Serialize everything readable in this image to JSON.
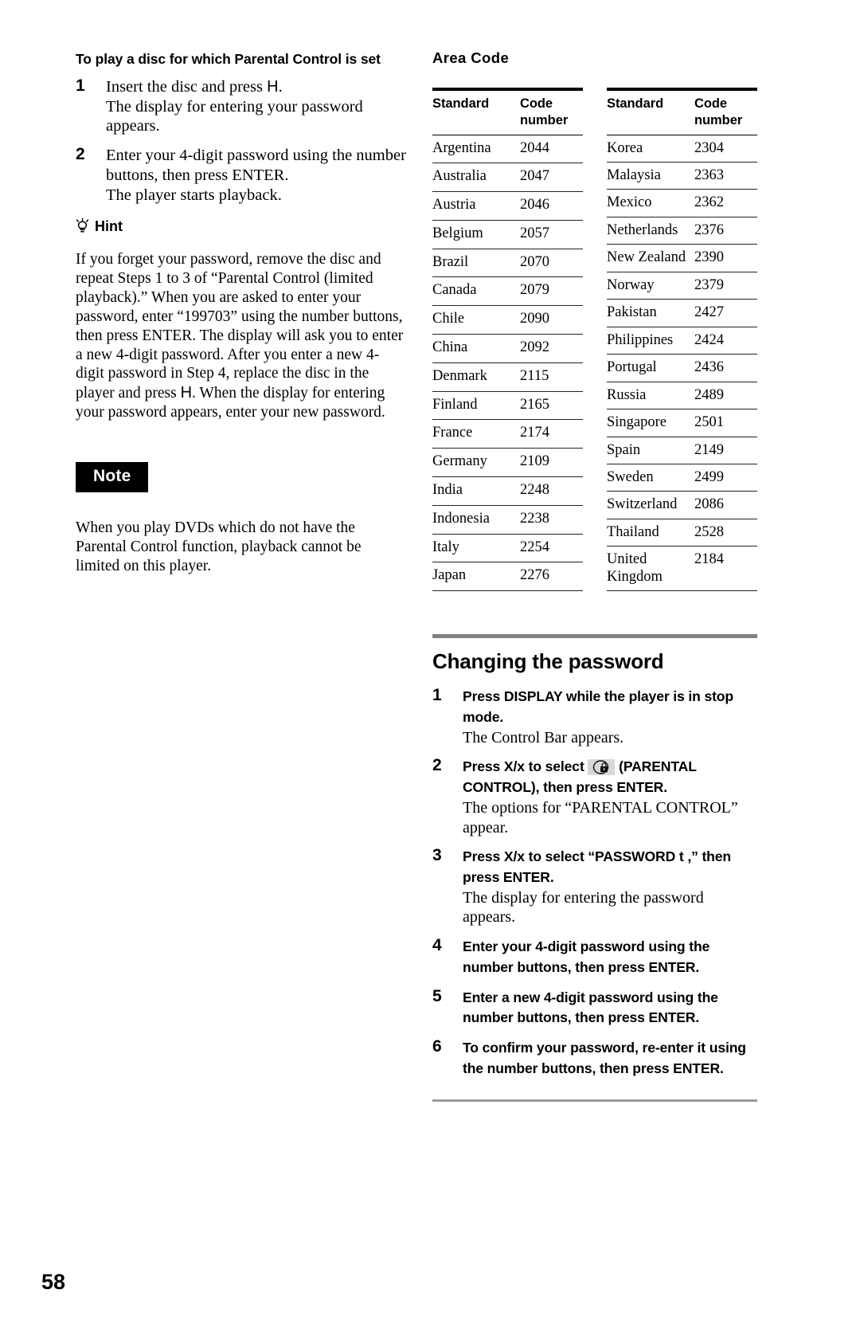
{
  "page": {
    "number": "58"
  },
  "left_column": {
    "heading": "To play a disc for which Parental Control is set",
    "steps": [
      {
        "num": "1",
        "main_pre": "Insert the disc and press ",
        "main_glyph": "H",
        "main_post": ".",
        "detail": "The display for entering your password appears."
      },
      {
        "num": "2",
        "main_pre": "Enter your 4-digit password using the number buttons, then press ENTER.",
        "main_glyph": "",
        "main_post": "",
        "detail": "The player starts playback."
      }
    ],
    "hint": {
      "icon": "lightbulb-icon",
      "label": "Hint",
      "text_part1": "If you forget your password, remove the disc and repeat Steps 1 to 3 of “Parental Control (limited playback).” When you are asked to enter your password, enter “199703” using the number buttons, then press ENTER. The display will ask you to enter a new 4-digit password. After you enter a new 4-digit password in Step 4, replace the disc in the player and press ",
      "glyph": "H",
      "text_part2": ". When the display for entering your password appears, enter your new password."
    },
    "note": {
      "label": "Note",
      "text": "When you play DVDs which do not have the Parental Control function, playback cannot be limited on this player."
    }
  },
  "right_column": {
    "area_code": {
      "title": "Area Code",
      "columns": [
        "Standard",
        "Code number"
      ],
      "table_left": [
        {
          "standard": "Argentina",
          "code": "2044"
        },
        {
          "standard": "Australia",
          "code": "2047"
        },
        {
          "standard": "Austria",
          "code": "2046"
        },
        {
          "standard": "Belgium",
          "code": "2057"
        },
        {
          "standard": "Brazil",
          "code": "2070"
        },
        {
          "standard": "Canada",
          "code": "2079"
        },
        {
          "standard": "Chile",
          "code": "2090"
        },
        {
          "standard": "China",
          "code": "2092"
        },
        {
          "standard": "Denmark",
          "code": "2115"
        },
        {
          "standard": "Finland",
          "code": "2165"
        },
        {
          "standard": "France",
          "code": "2174"
        },
        {
          "standard": "Germany",
          "code": "2109"
        },
        {
          "standard": "India",
          "code": "2248"
        },
        {
          "standard": "Indonesia",
          "code": "2238"
        },
        {
          "standard": "Italy",
          "code": "2254"
        },
        {
          "standard": "Japan",
          "code": "2276"
        }
      ],
      "table_right": [
        {
          "standard": "Korea",
          "code": "2304"
        },
        {
          "standard": "Malaysia",
          "code": "2363"
        },
        {
          "standard": "Mexico",
          "code": "2362"
        },
        {
          "standard": "Netherlands",
          "code": "2376"
        },
        {
          "standard": "New Zealand",
          "code": "2390"
        },
        {
          "standard": "Norway",
          "code": "2379"
        },
        {
          "standard": "Pakistan",
          "code": "2427"
        },
        {
          "standard": "Philippines",
          "code": "2424"
        },
        {
          "standard": "Portugal",
          "code": "2436"
        },
        {
          "standard": "Russia",
          "code": "2489"
        },
        {
          "standard": "Singapore",
          "code": "2501"
        },
        {
          "standard": "Spain",
          "code": "2149"
        },
        {
          "standard": "Sweden",
          "code": "2499"
        },
        {
          "standard": "Switzerland",
          "code": "2086"
        },
        {
          "standard": "Thailand",
          "code": "2528"
        },
        {
          "standard": "United Kingdom",
          "code": "2184"
        }
      ]
    },
    "changing_password": {
      "title": "Changing the password",
      "steps": [
        {
          "num": "1",
          "bold_a": "Press DISPLAY while the player is in stop mode.",
          "glyph": "",
          "bold_b": "",
          "detail": "The Control Bar appears."
        },
        {
          "num": "2",
          "bold_a": "Press X/x to select ",
          "glyph": "parental-lock-icon",
          "bold_b": " (PARENTAL CONTROL), then press ENTER.",
          "detail": "The options for “PARENTAL CONTROL” appear."
        },
        {
          "num": "3",
          "bold_a": "Press X/x to select “PASSWORD t ,” then press ENTER.",
          "glyph": "",
          "bold_b": "",
          "detail": "The display for entering the password appears."
        },
        {
          "num": "4",
          "bold_a": "Enter your 4-digit password using the number buttons, then press ENTER.",
          "glyph": "",
          "bold_b": "",
          "detail": ""
        },
        {
          "num": "5",
          "bold_a": "Enter a new 4-digit password using the number buttons, then press ENTER.",
          "glyph": "",
          "bold_b": "",
          "detail": ""
        },
        {
          "num": "6",
          "bold_a": "To confirm your password, re-enter it using the number buttons, then press ENTER.",
          "glyph": "",
          "bold_b": "",
          "detail": ""
        }
      ]
    }
  },
  "colors": {
    "text": "#000000",
    "note_badge_bg": "#000000",
    "note_badge_fg": "#ffffff",
    "section_rule": "#808080",
    "bottom_rule": "#9a9a9a",
    "lock_chip_bg": "#d8d8d8"
  }
}
